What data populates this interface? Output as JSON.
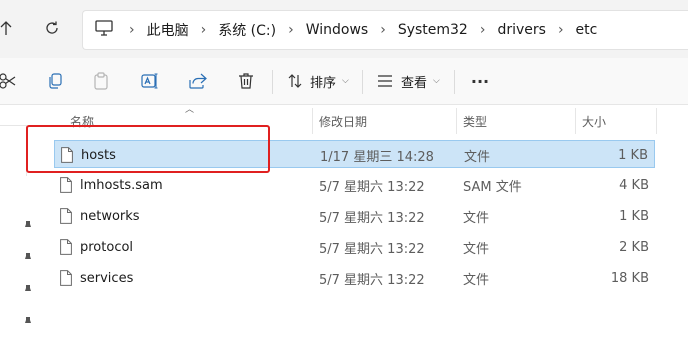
{
  "address_bar": {
    "breadcrumbs": [
      "此电脑",
      "系统 (C:)",
      "Windows",
      "System32",
      "drivers",
      "etc"
    ],
    "separator": "›"
  },
  "toolbar": {
    "sort_label": "排序",
    "view_label": "查看",
    "more_label": "···"
  },
  "columns": {
    "name": "名称",
    "date": "修改日期",
    "type": "类型",
    "size": "大小"
  },
  "files": [
    {
      "name": "hosts",
      "date": "1/17 星期三 14:28",
      "type": "文件",
      "size": "1 KB",
      "selected": true
    },
    {
      "name": "lmhosts.sam",
      "date": "5/7 星期六 13:22",
      "type": "SAM 文件",
      "size": "4 KB"
    },
    {
      "name": "networks",
      "date": "5/7 星期六 13:22",
      "type": "文件",
      "size": "1 KB"
    },
    {
      "name": "protocol",
      "date": "5/7 星期六 13:22",
      "type": "文件",
      "size": "2 KB"
    },
    {
      "name": "services",
      "date": "5/7 星期六 13:22",
      "type": "文件",
      "size": "18 KB"
    }
  ],
  "colors": {
    "selection_bg": "#cce4f7",
    "selection_border": "#99c9ef",
    "annotation_red": "#e02020"
  }
}
